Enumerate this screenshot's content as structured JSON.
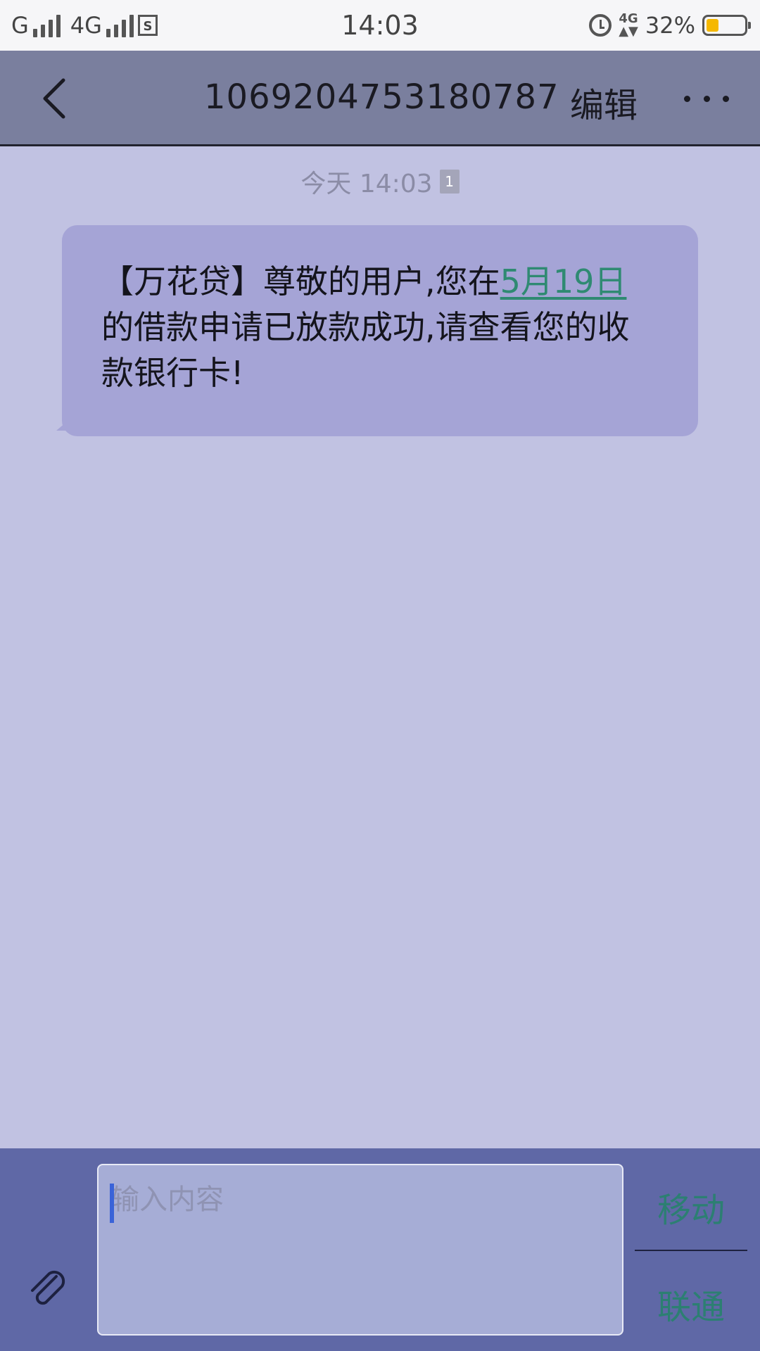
{
  "status_bar": {
    "carrier_1": "G",
    "carrier_2": "4G",
    "time": "14:03",
    "network_badge": "4G",
    "battery_percent": "32%",
    "battery_level": 0.32
  },
  "header": {
    "title": "1069204753180787",
    "edit_label": "编辑"
  },
  "conversation": {
    "timestamp": "今天 14:03",
    "sim_badge": "1",
    "message": {
      "text_before": "【万花贷】尊敬的用户,您在",
      "date_link": "5月19日",
      "text_after": "的借款申请已放款成功,请查看您的收款银行卡!"
    }
  },
  "composer": {
    "placeholder": "输入内容",
    "send_sim1": "移动",
    "send_sim2": "联通"
  },
  "colors": {
    "header": "#7a7f9e",
    "background": "#c1c2e2",
    "bubble": "#a5a4d6",
    "link": "#2f8a72",
    "input_bar": "#5f68a6"
  }
}
